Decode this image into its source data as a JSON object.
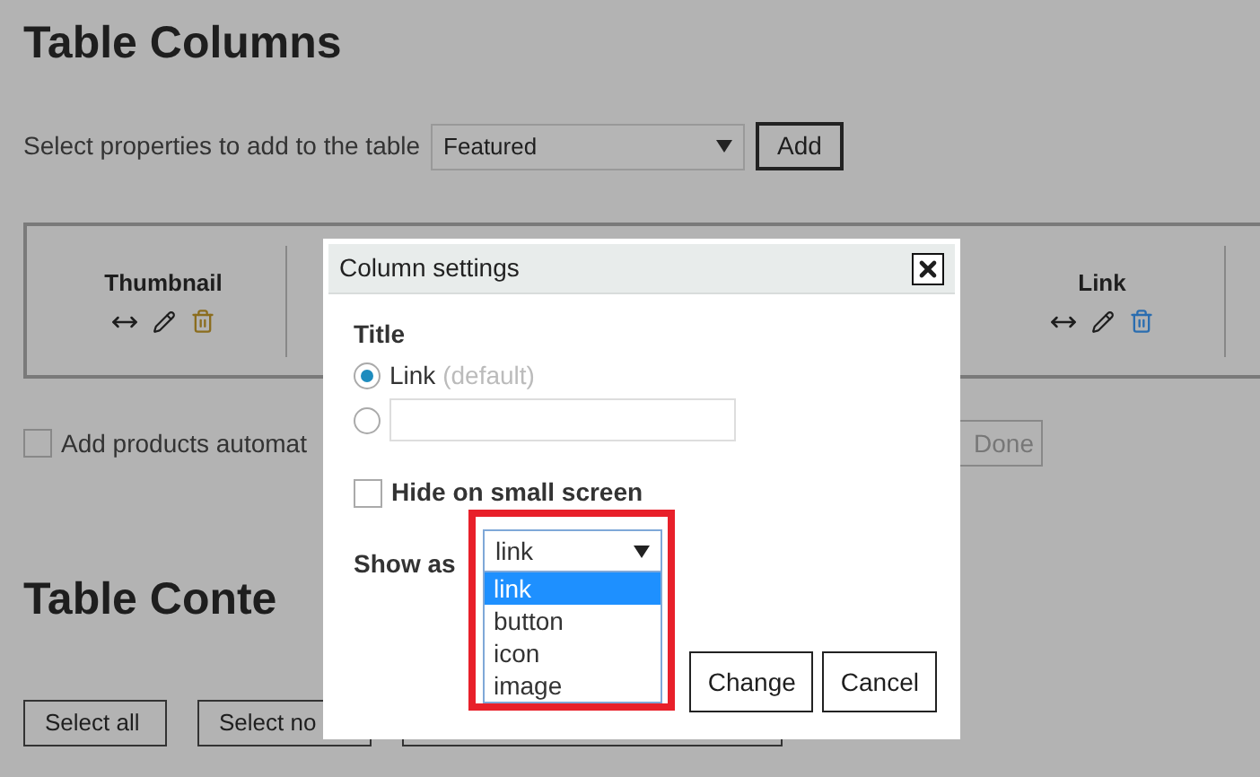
{
  "page": {
    "title": "Table Columns",
    "properties_label": "Select properties to add to the table",
    "properties_select": {
      "value": "Featured"
    },
    "add_button": "Add",
    "columns": [
      {
        "title": "Thumbnail",
        "color": "#8b6d1e"
      },
      {
        "title": "Link",
        "color": "#2a6db0"
      }
    ],
    "auto_add": {
      "label": "Add products automat",
      "checked": false
    },
    "done_button": "Done",
    "content_title": "Table Conte",
    "content_buttons": [
      "Select all",
      "Select no"
    ]
  },
  "dialog": {
    "title": "Column settings",
    "title_label": "Title",
    "title_options": [
      {
        "kind": "default",
        "label": "Link",
        "hint": "(default)",
        "selected": true
      },
      {
        "kind": "custom",
        "selected": false
      }
    ],
    "hide_small": {
      "label": "Hide on small screen",
      "checked": false
    },
    "show_as": {
      "label": "Show as",
      "value": "link",
      "options": [
        {
          "label": "link",
          "selected": true
        },
        {
          "label": "button",
          "selected": false
        },
        {
          "label": "icon",
          "selected": false
        },
        {
          "label": "image",
          "selected": false
        }
      ]
    },
    "buttons": [
      "Change",
      "Cancel"
    ]
  }
}
